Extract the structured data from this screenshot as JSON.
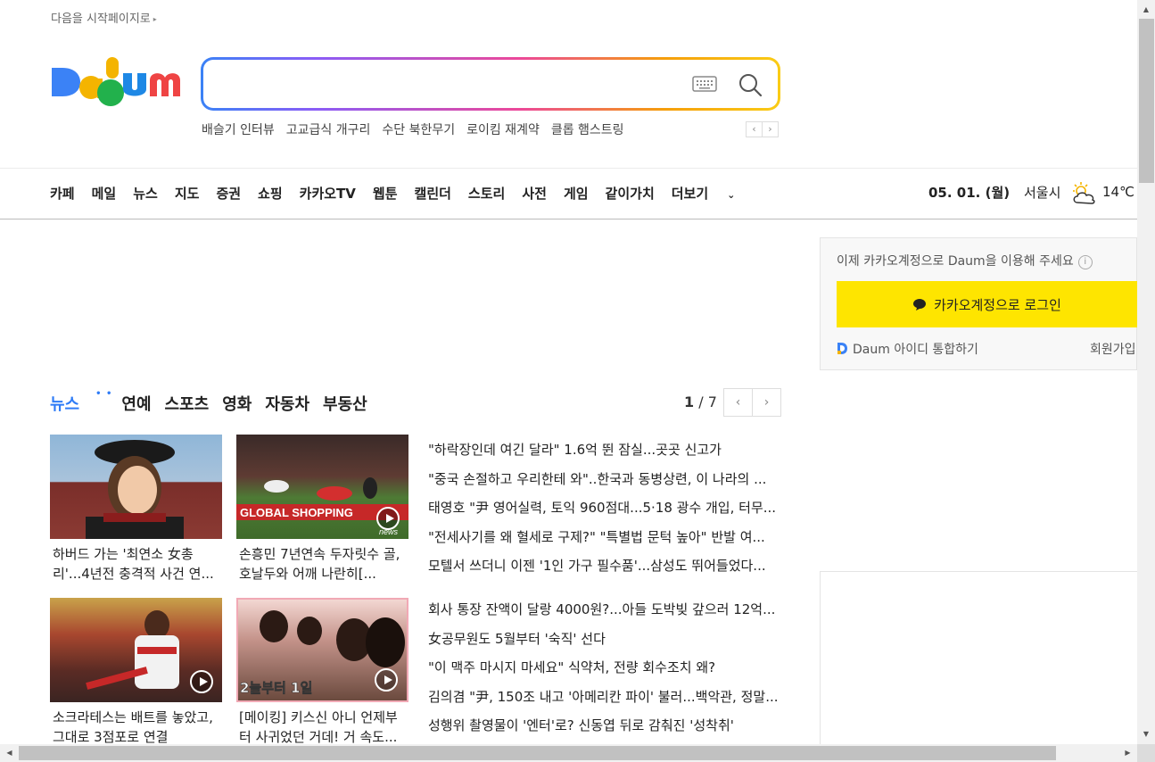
{
  "header": {
    "start_page": "다음을 시작페이지로",
    "start_page_arrow": "▸",
    "logo_text": "Daum"
  },
  "search": {
    "value": "",
    "placeholder": ""
  },
  "hot_keywords": [
    "배슬기 인터뷰",
    "고교급식 개구리",
    "수단 북한무기",
    "로이킴 재계약",
    "클롭 햄스트링"
  ],
  "hot_nav": {
    "prev": "‹",
    "next": "›"
  },
  "gnb": {
    "items": [
      "카페",
      "메일",
      "뉴스",
      "지도",
      "증권",
      "쇼핑",
      "카카오TV",
      "웹툰",
      "캘린더",
      "스토리",
      "사전",
      "게임",
      "같이가치",
      "더보기"
    ],
    "more_chevron": "⌄",
    "date": "05. 01. (월)",
    "city": "서울시",
    "temp": "14℃",
    "weather_icon": "partly-cloudy-icon"
  },
  "login": {
    "message": "이제 카카오계정으로 Daum을 이용해 주세요",
    "info": "i",
    "kakao_button": "카카오계정으로 로그인",
    "daum_link": "Daum 아이디 통합하기",
    "signup": "회원가입"
  },
  "news": {
    "tabs": [
      "뉴스",
      "연예",
      "스포츠",
      "영화",
      "자동차",
      "부동산"
    ],
    "tab_dots": "• •",
    "page_current": "1",
    "page_total": " / 7",
    "prev": "‹",
    "next": "›",
    "cards": [
      {
        "caption": "하버드 가는 '최연소 女총리'...4년전 충격적 사건 연...",
        "video": false
      },
      {
        "caption": "손흥민 7년연속 두자릿수 골, 호날두와 어깨 나란히[...",
        "video": true
      },
      {
        "caption": "소크라테스는 배트를 놓았고, 그대로 3점포로 연결",
        "video": true
      },
      {
        "caption": "[메이킹] 키스신 아니 언제부터 사귀었던 거데! 거 속도...",
        "video": true
      }
    ],
    "headlines_top": [
      "\"하락장인데 여긴 달라\" 1.6억 뛴 잠실...곳곳 신고가",
      "\"중국 손절하고 우리한테 와\"..한국과 동병상련, 이 나라의 ...",
      "태영호 \"尹 영어실력, 토익 960점대...5·18 광수 개입, 터무...",
      "\"전세사기를 왜 혈세로 구제?\" \"특별법 문턱 높아\" 반발 여...",
      "모텔서 쓰더니 이젠 '1인 가구 필수품'...삼성도 뛰어들었다..."
    ],
    "headlines_bottom": [
      "회사 통장 잔액이 달랑 4000원?...아들 도박빚 갚으러 12억...",
      "女공무원도 5월부터 '숙직' 선다",
      "\"이 맥주 마시지 마세요\" 식약처, 전량 회수조치 왜?",
      "김의겸 \"尹, 150조 내고 '아메리칸 파이' 불러...백악관, 정말...",
      "성행위 촬영물이 '엔터'로? 신동엽 뒤로 감춰진 '성착취'"
    ]
  },
  "scrollbar": {
    "up": "▲",
    "down": "▼",
    "left": "◀",
    "right": "▶"
  }
}
